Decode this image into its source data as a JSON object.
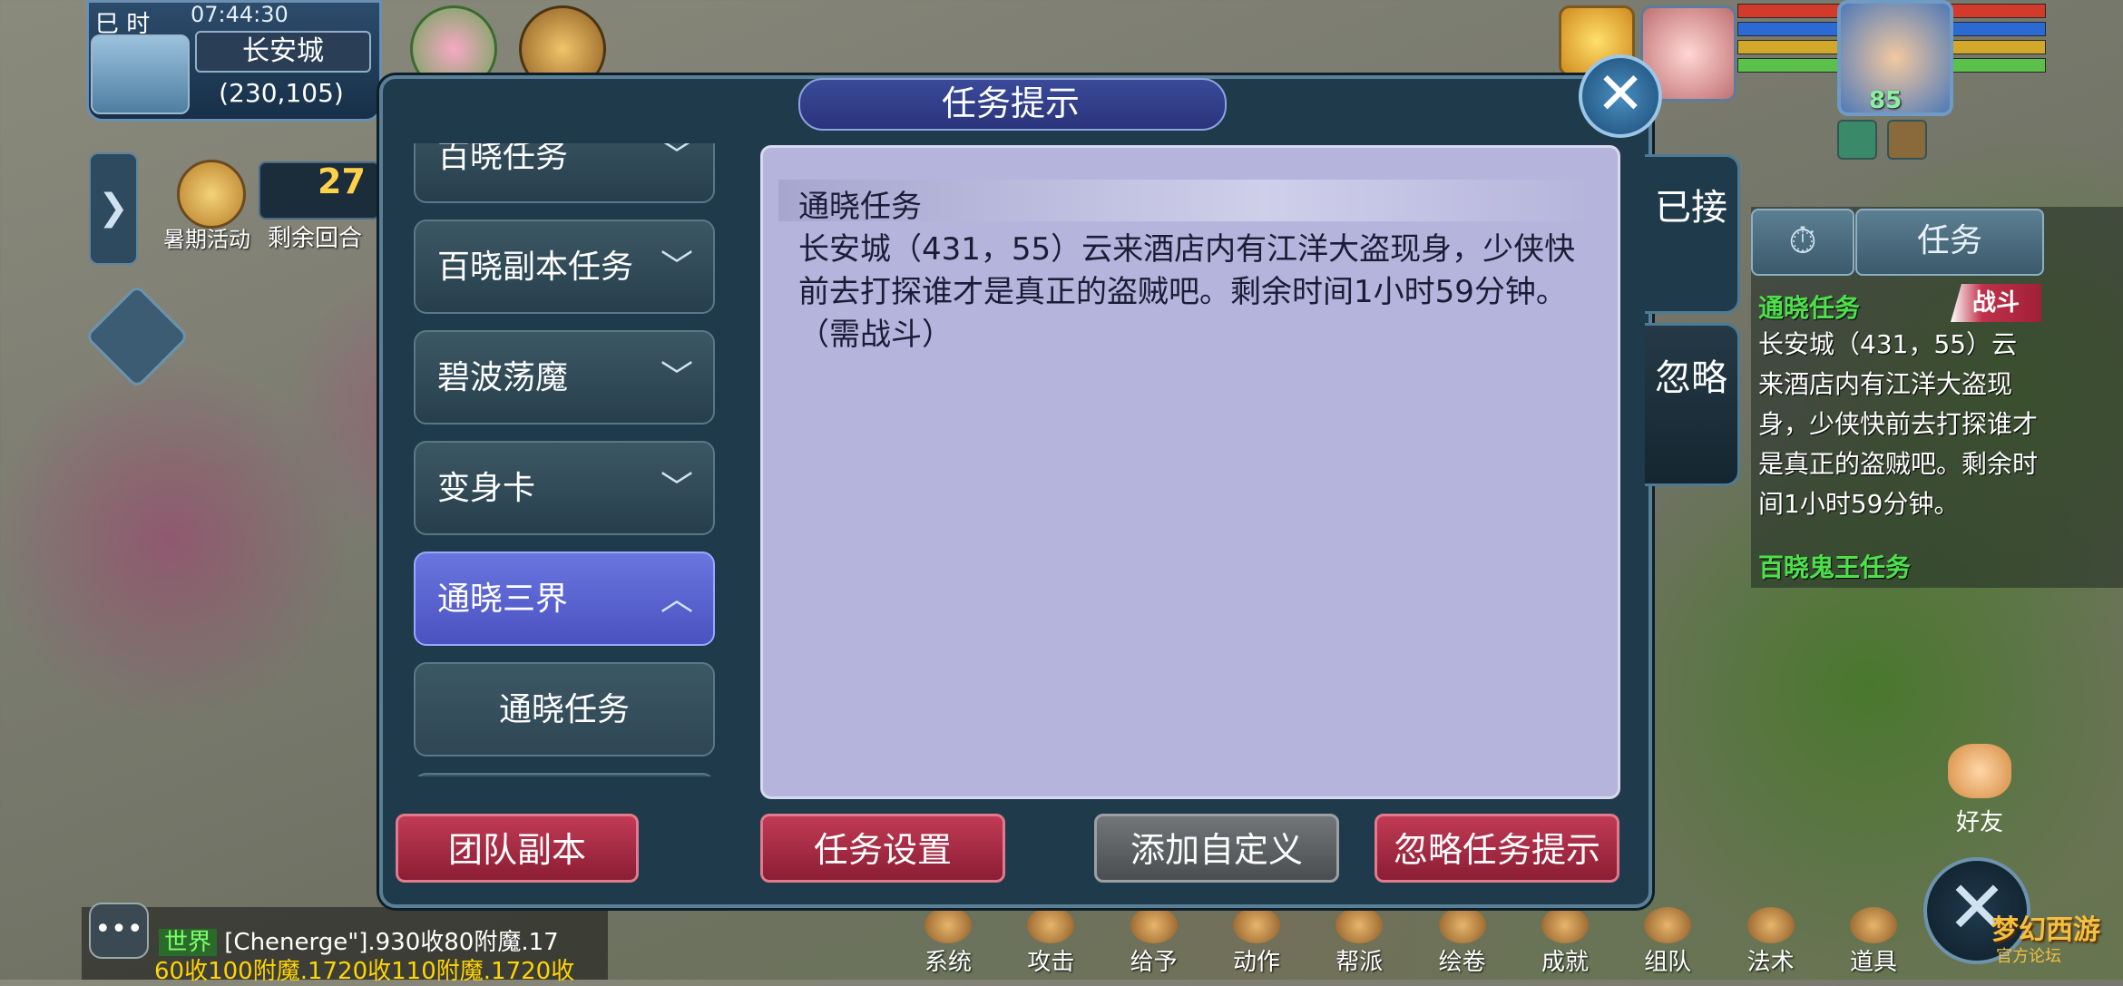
{
  "hud": {
    "time_tag": "巳 时",
    "time": "07:44:30",
    "city": "长安城",
    "coords": "(230,105)",
    "round_count": "27",
    "round_label": "剩余回合",
    "event_label": "暑期活动"
  },
  "player": {
    "level": "85"
  },
  "dialog": {
    "title": "任务提示",
    "categories": [
      {
        "label": "百晓任务",
        "state": "collapsed"
      },
      {
        "label": "百晓副本任务",
        "state": "collapsed"
      },
      {
        "label": "碧波荡魔",
        "state": "collapsed"
      },
      {
        "label": "变身卡",
        "state": "collapsed"
      },
      {
        "label": "通晓三界",
        "state": "expanded"
      }
    ],
    "subitem": "通晓任务",
    "content": {
      "title": "通晓任务",
      "text": "长安城（431，55）云来酒店内有江洋大盗现身，少侠快前去打探谁才是真正的盗贼吧。剩余时间1小时59分钟。（需战斗）"
    },
    "side_tabs": [
      "已接",
      "忽略"
    ],
    "buttons": {
      "team_dungeon": "团队副本",
      "task_settings": "任务设置",
      "add_custom": "添加自定义",
      "ignore_tips": "忽略任务提示"
    }
  },
  "tracker": {
    "tab": "任务",
    "task_title": "通晓任务",
    "badge": "战斗",
    "task_text": "长安城（431，55）云来酒店内有江洋大盗现身，少侠快前去打探谁才是真正的盗贼吧。剩余时间1小时59分钟。",
    "next_task": "百晓鬼王任务"
  },
  "bottom_menu": [
    "系统",
    "攻击",
    "给予",
    "动作",
    "帮派",
    "绘卷",
    "成就",
    "组队",
    "法术",
    "道具"
  ],
  "friend_label": "好友",
  "chat": {
    "channel": "世界",
    "line1": "[Chenerge\"].930收80附魔.17",
    "line2": "60收100附魔.1720收110附魔.1720收"
  },
  "logo": {
    "main": "梦幻西游",
    "sub": "官方论坛"
  },
  "colors": {
    "dialog_bg": "#1f3a4a",
    "content_bg": "#b5b4dc",
    "active_category": "#5a64d6",
    "red_button": "#a82a44",
    "grey_button": "#5c6062",
    "task_green": "#4de04b",
    "badge_red": "#b02840"
  },
  "icons": {
    "close": "close-icon",
    "chevron_down": "chevron-down-icon",
    "chevron_up": "chevron-up-icon",
    "clock": "clock-icon"
  }
}
